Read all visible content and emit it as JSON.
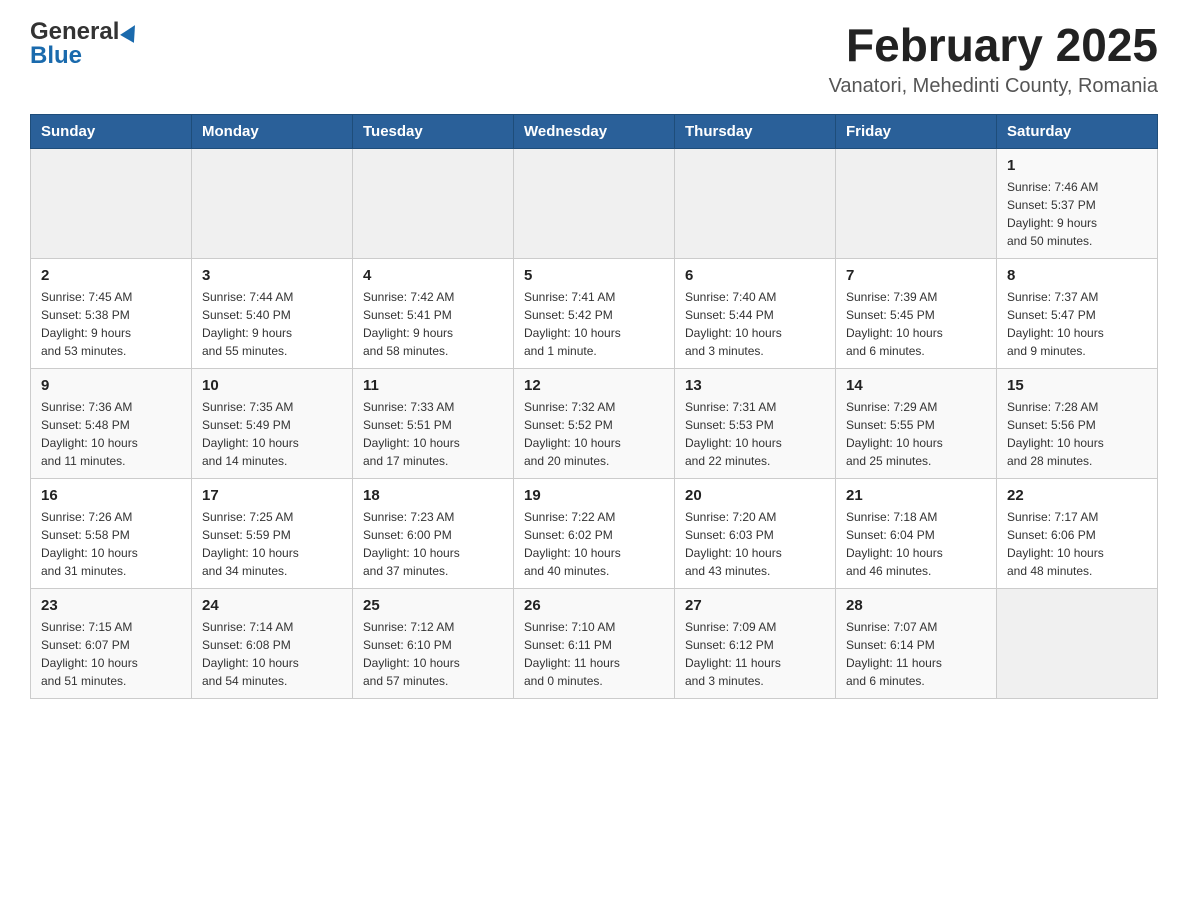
{
  "header": {
    "logo_general": "General",
    "logo_blue": "Blue",
    "month_title": "February 2025",
    "location": "Vanatori, Mehedinti County, Romania"
  },
  "calendar": {
    "days_of_week": [
      "Sunday",
      "Monday",
      "Tuesday",
      "Wednesday",
      "Thursday",
      "Friday",
      "Saturday"
    ],
    "weeks": [
      [
        {
          "day": "",
          "info": ""
        },
        {
          "day": "",
          "info": ""
        },
        {
          "day": "",
          "info": ""
        },
        {
          "day": "",
          "info": ""
        },
        {
          "day": "",
          "info": ""
        },
        {
          "day": "",
          "info": ""
        },
        {
          "day": "1",
          "info": "Sunrise: 7:46 AM\nSunset: 5:37 PM\nDaylight: 9 hours\nand 50 minutes."
        }
      ],
      [
        {
          "day": "2",
          "info": "Sunrise: 7:45 AM\nSunset: 5:38 PM\nDaylight: 9 hours\nand 53 minutes."
        },
        {
          "day": "3",
          "info": "Sunrise: 7:44 AM\nSunset: 5:40 PM\nDaylight: 9 hours\nand 55 minutes."
        },
        {
          "day": "4",
          "info": "Sunrise: 7:42 AM\nSunset: 5:41 PM\nDaylight: 9 hours\nand 58 minutes."
        },
        {
          "day": "5",
          "info": "Sunrise: 7:41 AM\nSunset: 5:42 PM\nDaylight: 10 hours\nand 1 minute."
        },
        {
          "day": "6",
          "info": "Sunrise: 7:40 AM\nSunset: 5:44 PM\nDaylight: 10 hours\nand 3 minutes."
        },
        {
          "day": "7",
          "info": "Sunrise: 7:39 AM\nSunset: 5:45 PM\nDaylight: 10 hours\nand 6 minutes."
        },
        {
          "day": "8",
          "info": "Sunrise: 7:37 AM\nSunset: 5:47 PM\nDaylight: 10 hours\nand 9 minutes."
        }
      ],
      [
        {
          "day": "9",
          "info": "Sunrise: 7:36 AM\nSunset: 5:48 PM\nDaylight: 10 hours\nand 11 minutes."
        },
        {
          "day": "10",
          "info": "Sunrise: 7:35 AM\nSunset: 5:49 PM\nDaylight: 10 hours\nand 14 minutes."
        },
        {
          "day": "11",
          "info": "Sunrise: 7:33 AM\nSunset: 5:51 PM\nDaylight: 10 hours\nand 17 minutes."
        },
        {
          "day": "12",
          "info": "Sunrise: 7:32 AM\nSunset: 5:52 PM\nDaylight: 10 hours\nand 20 minutes."
        },
        {
          "day": "13",
          "info": "Sunrise: 7:31 AM\nSunset: 5:53 PM\nDaylight: 10 hours\nand 22 minutes."
        },
        {
          "day": "14",
          "info": "Sunrise: 7:29 AM\nSunset: 5:55 PM\nDaylight: 10 hours\nand 25 minutes."
        },
        {
          "day": "15",
          "info": "Sunrise: 7:28 AM\nSunset: 5:56 PM\nDaylight: 10 hours\nand 28 minutes."
        }
      ],
      [
        {
          "day": "16",
          "info": "Sunrise: 7:26 AM\nSunset: 5:58 PM\nDaylight: 10 hours\nand 31 minutes."
        },
        {
          "day": "17",
          "info": "Sunrise: 7:25 AM\nSunset: 5:59 PM\nDaylight: 10 hours\nand 34 minutes."
        },
        {
          "day": "18",
          "info": "Sunrise: 7:23 AM\nSunset: 6:00 PM\nDaylight: 10 hours\nand 37 minutes."
        },
        {
          "day": "19",
          "info": "Sunrise: 7:22 AM\nSunset: 6:02 PM\nDaylight: 10 hours\nand 40 minutes."
        },
        {
          "day": "20",
          "info": "Sunrise: 7:20 AM\nSunset: 6:03 PM\nDaylight: 10 hours\nand 43 minutes."
        },
        {
          "day": "21",
          "info": "Sunrise: 7:18 AM\nSunset: 6:04 PM\nDaylight: 10 hours\nand 46 minutes."
        },
        {
          "day": "22",
          "info": "Sunrise: 7:17 AM\nSunset: 6:06 PM\nDaylight: 10 hours\nand 48 minutes."
        }
      ],
      [
        {
          "day": "23",
          "info": "Sunrise: 7:15 AM\nSunset: 6:07 PM\nDaylight: 10 hours\nand 51 minutes."
        },
        {
          "day": "24",
          "info": "Sunrise: 7:14 AM\nSunset: 6:08 PM\nDaylight: 10 hours\nand 54 minutes."
        },
        {
          "day": "25",
          "info": "Sunrise: 7:12 AM\nSunset: 6:10 PM\nDaylight: 10 hours\nand 57 minutes."
        },
        {
          "day": "26",
          "info": "Sunrise: 7:10 AM\nSunset: 6:11 PM\nDaylight: 11 hours\nand 0 minutes."
        },
        {
          "day": "27",
          "info": "Sunrise: 7:09 AM\nSunset: 6:12 PM\nDaylight: 11 hours\nand 3 minutes."
        },
        {
          "day": "28",
          "info": "Sunrise: 7:07 AM\nSunset: 6:14 PM\nDaylight: 11 hours\nand 6 minutes."
        },
        {
          "day": "",
          "info": ""
        }
      ]
    ]
  }
}
